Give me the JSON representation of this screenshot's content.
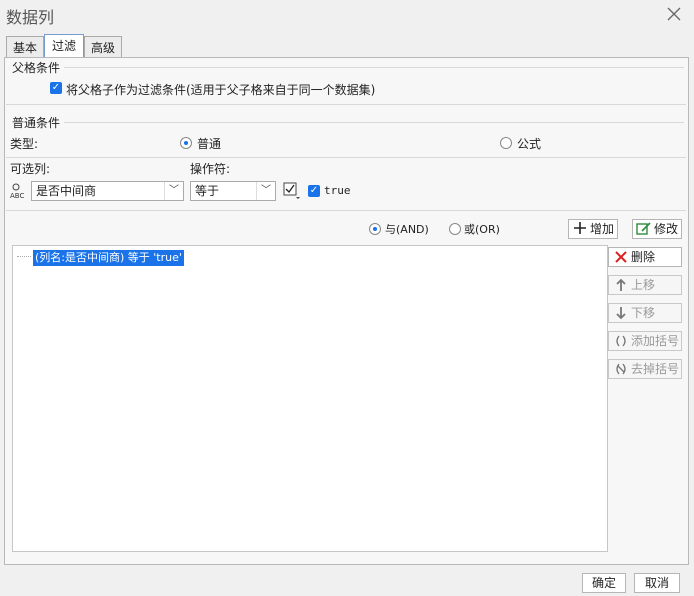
{
  "window": {
    "title": "数据列"
  },
  "tabs": [
    {
      "label": "基本"
    },
    {
      "label": "过滤"
    },
    {
      "label": "高级"
    }
  ],
  "parent_condition": {
    "section_title": "父格条件",
    "checkbox_label": "将父格子作为过滤条件(适用于父子格来自于同一个数据集)",
    "checked": true
  },
  "normal_condition": {
    "section_title": "普通条件",
    "type_label": "类型:",
    "type_options": [
      {
        "label": "普通",
        "selected": true
      },
      {
        "label": "公式",
        "selected": false
      }
    ],
    "column_label": "可选列:",
    "column_value": "是否中间商",
    "operator_label": "操作符:",
    "operator_value": "等于",
    "value_checkbox_label": "true",
    "value_checked": true
  },
  "logic": {
    "and_label": "与(AND)",
    "or_label": "或(OR)",
    "and_selected": true,
    "add_label": "增加",
    "modify_label": "修改"
  },
  "conditions_list": [
    {
      "text": "(列名:是否中间商) 等于 'true'"
    }
  ],
  "side_buttons": {
    "delete": "删除",
    "move_up": "上移",
    "move_down": "下移",
    "add_bracket": "添加括号",
    "remove_bracket": "去掉括号"
  },
  "footer": {
    "ok": "确定",
    "cancel": "取消"
  },
  "colors": {
    "accent": "#1a73e8",
    "delete_red": "#e02020",
    "modify_green": "#2e8b3a"
  }
}
